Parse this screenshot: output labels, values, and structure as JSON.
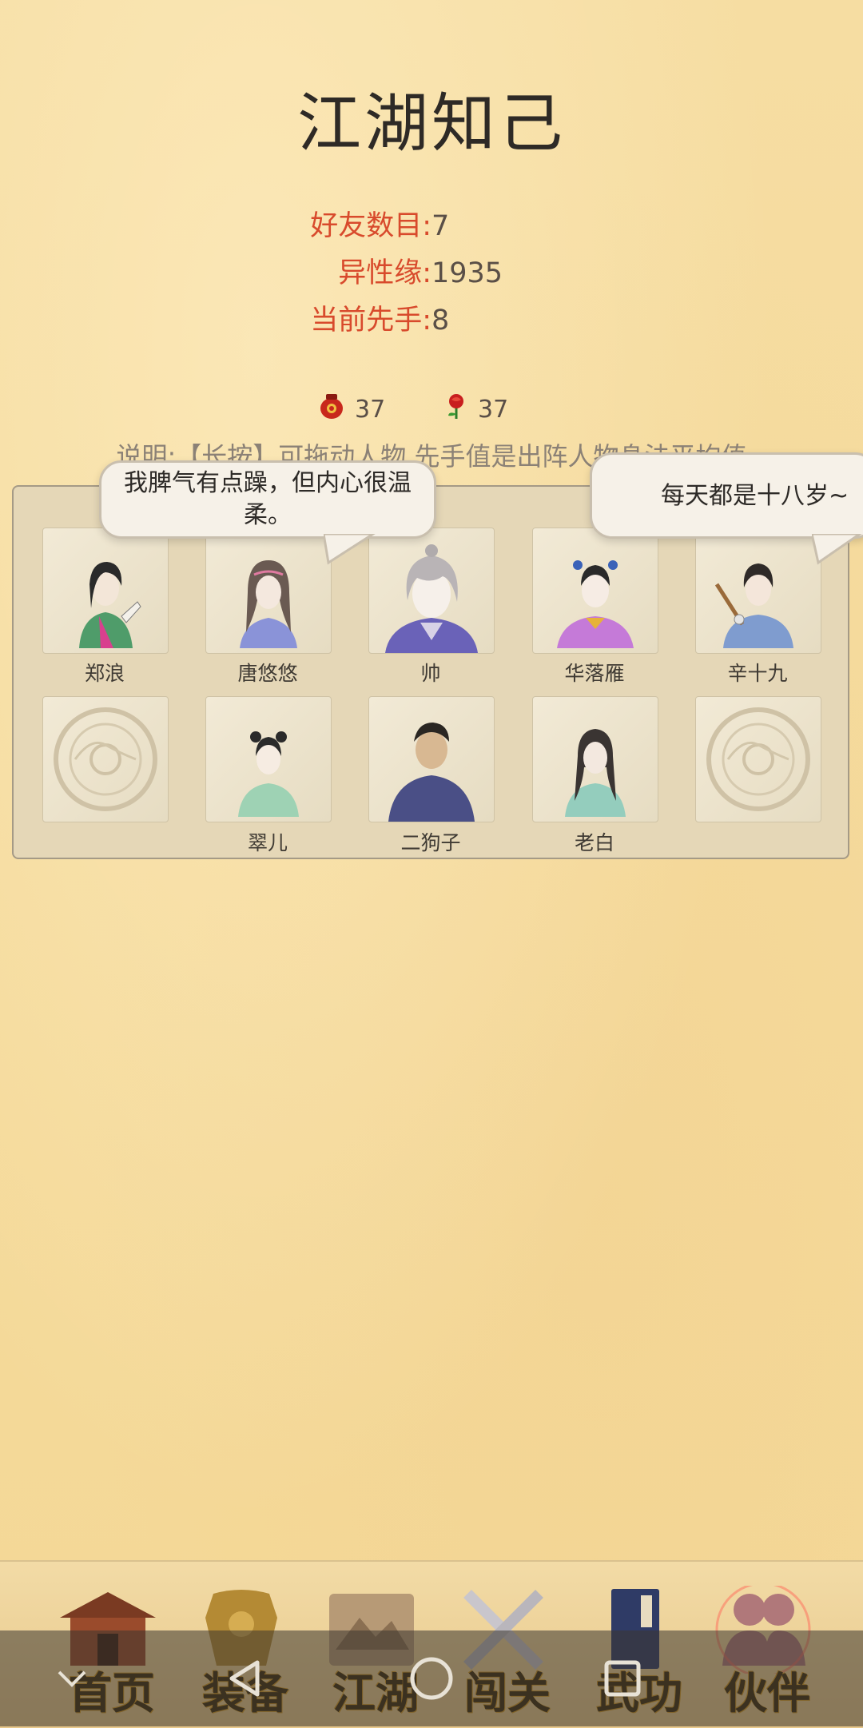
{
  "title": "江湖知己",
  "stats": [
    {
      "label": "好友数目:",
      "value": "7"
    },
    {
      "label": "异性缘:",
      "value": "1935"
    },
    {
      "label": "当前先手:",
      "value": "8"
    }
  ],
  "resources": [
    {
      "icon": "wine-jar-icon",
      "value": "37"
    },
    {
      "icon": "rose-icon",
      "value": "37"
    }
  ],
  "description": "说明:【长按】可拖动人物,先手值是出阵人物身法平均值",
  "bubbles": [
    {
      "text": "我脾气有点躁，但内心很温柔。"
    },
    {
      "text": "每天都是十八岁~"
    }
  ],
  "partners": [
    {
      "name": "郑浪"
    },
    {
      "name": "唐悠悠"
    },
    {
      "name": "帅"
    },
    {
      "name": "华落雁"
    },
    {
      "name": "辛十九"
    },
    {
      "name": ""
    },
    {
      "name": "翠儿"
    },
    {
      "name": "二狗子"
    },
    {
      "name": "老白"
    },
    {
      "name": ""
    }
  ],
  "nav": [
    {
      "label": "首页",
      "icon": "home-building-icon"
    },
    {
      "label": "装备",
      "icon": "armor-icon"
    },
    {
      "label": "江湖",
      "icon": "scroll-map-icon"
    },
    {
      "label": "闯关",
      "icon": "crossed-swords-icon"
    },
    {
      "label": "武功",
      "icon": "martial-book-icon"
    },
    {
      "label": "伙伴",
      "icon": "partners-icon"
    }
  ],
  "system_nav": [
    "back",
    "home",
    "recents"
  ]
}
